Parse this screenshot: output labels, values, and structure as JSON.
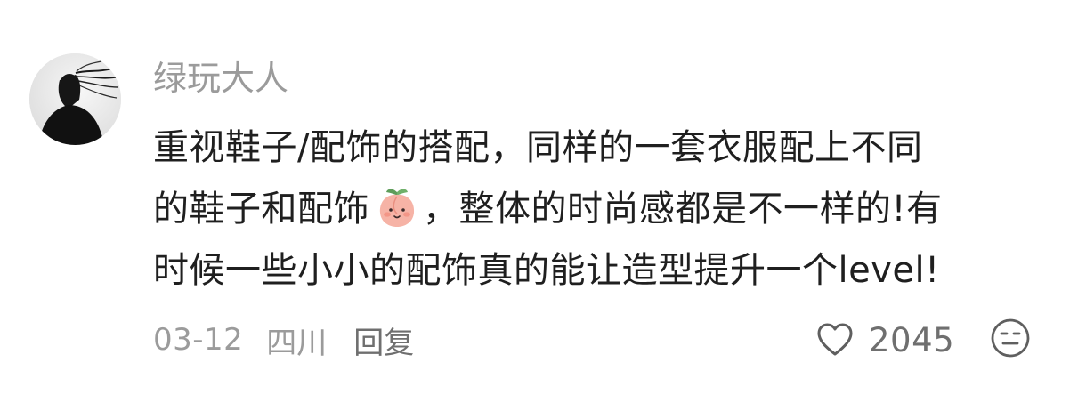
{
  "comment": {
    "username": "绿玩大人",
    "content_lines": [
      "重视鞋子/配饰的搭配，同样的一套衣服配上不同",
      "的鞋子和配饰",
      "，整体的时尚感都是不一样的!有",
      "时候一些小小的配饰真的能让造型提升一个level!"
    ],
    "emoji": "peach-face-emoji",
    "date": "03-12",
    "location": "四川",
    "reply_label": "回复",
    "like_count": "2045",
    "icons": {
      "like": "heart-outline-icon",
      "react": "neutral-face-icon"
    },
    "colors": {
      "text": "#1f1f1f",
      "muted": "#9b9b9b",
      "secondary": "#6f6f6f",
      "peach": "#f4a79a",
      "leaf": "#5e9d5a"
    }
  }
}
